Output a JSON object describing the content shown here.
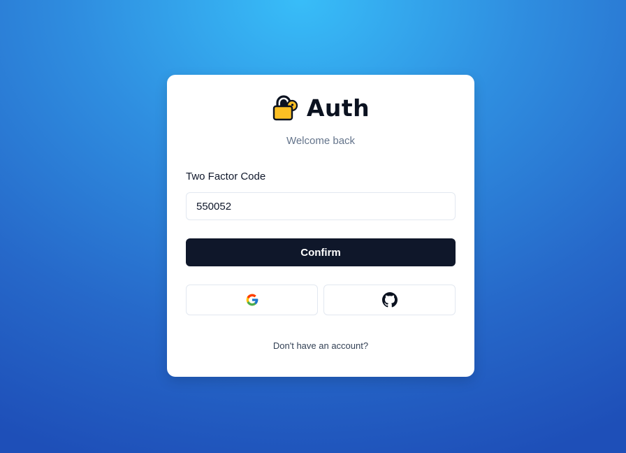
{
  "brand": {
    "title": "Auth",
    "logo_icon": "padlock-icon",
    "logo_color": "#fbbf24"
  },
  "subtitle": "Welcome back",
  "form": {
    "code_label": "Two Factor Code",
    "code_value": "550052",
    "confirm_label": "Confirm"
  },
  "social": [
    {
      "provider": "Google",
      "icon": "google-icon"
    },
    {
      "provider": "GitHub",
      "icon": "github-icon"
    }
  ],
  "footer": {
    "signup_link": "Don't have an account?"
  },
  "colors": {
    "primary_button": "#0f172a",
    "background_gradient": [
      "#38bdf8",
      "#1e4fb8"
    ]
  }
}
